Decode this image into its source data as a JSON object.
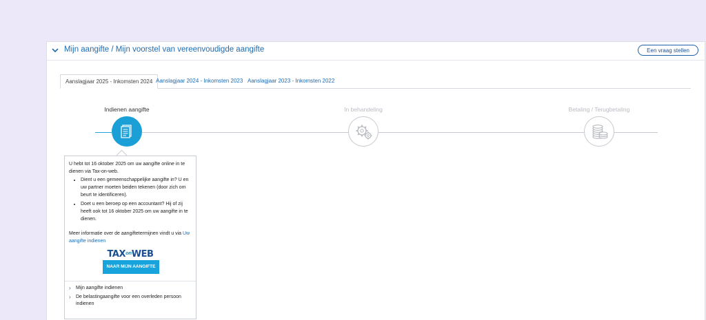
{
  "header": {
    "title": "Mijn aangifte / Mijn voorstel van vereenvoudigde aangifte",
    "ask_button": "Een vraag stellen"
  },
  "tabs": [
    {
      "label": "Aanslagjaar 2025 - Inkomsten 2024",
      "active": true
    },
    {
      "label": "Aanslagjaar 2024 - Inkomsten 2023",
      "active": false
    },
    {
      "label": "Aanslagjaar 2023 - Inkomsten 2022",
      "active": false
    }
  ],
  "steps": [
    {
      "label": "Indienen aangifte",
      "active": true,
      "icon": "document-icon"
    },
    {
      "label": "In behandeling",
      "active": false,
      "icon": "gears-icon"
    },
    {
      "label": "Betaling / Terugbetaling",
      "active": false,
      "icon": "coins-icon"
    }
  ],
  "popover": {
    "intro": "U hebt tot 16 oktober 2025 om uw aangifte online in te dienen via Tax-on-web.",
    "bullets": [
      "Dient u een gemeenschappelijke aangifte in? U en uw partner moeten beiden tekenen (door zich om beurt te identificeren).",
      "Doet u een beroep op een accountant? Hij of zij heeft ook tot 16 oktober 2025 om uw aangifte in te dienen."
    ],
    "more_text": "Meer informatie over de aangiftetermijnen vindt u via ",
    "more_link": "Uw aangifte indienen",
    "logo_tax": "TAX",
    "logo_on": "on",
    "logo_web": "WEB",
    "cta": "NAAR MIJN AANGIFTE",
    "links": [
      "Mijn aangifte indienen",
      "De belastingaangifte voor een overleden persoon indienen"
    ]
  },
  "colors": {
    "background": "#ece8fa",
    "accent": "#1aa0d6",
    "link": "#1f6bb0",
    "inactive": "#c6c9cf"
  }
}
